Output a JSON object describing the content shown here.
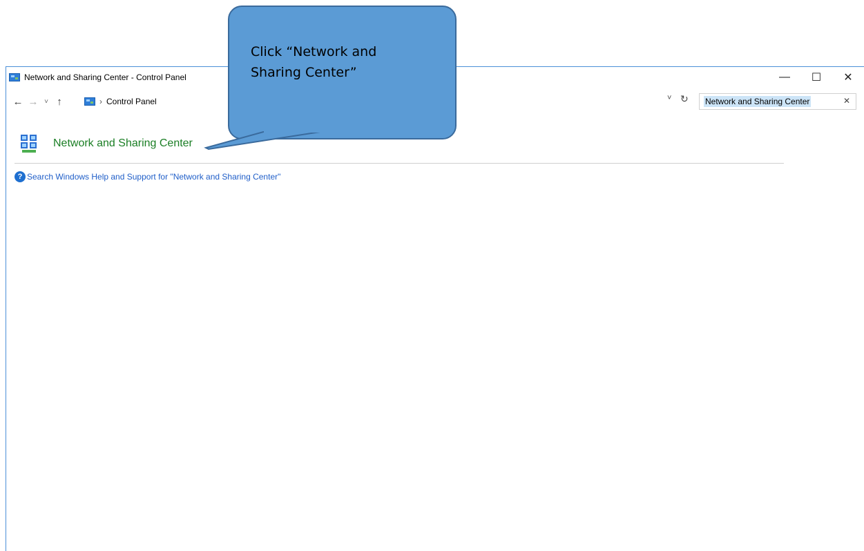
{
  "window": {
    "title": "Network and Sharing Center - Control Panel",
    "controls": {
      "minimize": "—",
      "maximize": "☐",
      "close": "✕"
    }
  },
  "nav": {
    "back": "←",
    "forward": "→",
    "recent": "˅",
    "up": "↑",
    "breadcrumb_separator": "›",
    "breadcrumb": "Control Panel",
    "dropdown": "˅",
    "refresh": "↻"
  },
  "search": {
    "value": "Network and Sharing Center",
    "clear": "✕"
  },
  "results": {
    "title": "Network and Sharing Center",
    "help_icon": "?",
    "help_link": "Search Windows Help and Support for \"Network and Sharing Center\""
  },
  "callout": {
    "text": "Click “Network and Sharing Center”"
  },
  "icons": {
    "app": "control-panel-icon",
    "result": "network-sharing-icon",
    "help": "help-icon"
  }
}
